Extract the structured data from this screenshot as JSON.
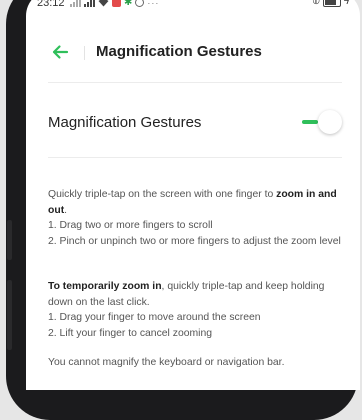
{
  "status": {
    "time": "23:12",
    "more": "···"
  },
  "header": {
    "title": "Magnification Gestures"
  },
  "setting": {
    "label": "Magnification Gestures",
    "enabled": true
  },
  "colors": {
    "accent": "#2fbf5a"
  },
  "icons": {
    "back": "arrow-left-icon"
  },
  "description": {
    "para1": {
      "lead": "Quickly triple-tap on the screen with one finger to ",
      "bold": "zoom in and out",
      "tail": ".",
      "item1": "1. Drag two or more fingers to scroll",
      "item2": "2. Pinch or unpinch two or more fingers to adjust the zoom level"
    },
    "para2": {
      "bold": "To temporarily zoom in",
      "tail": ", quickly triple-tap and keep holding down on the last click.",
      "item1": "1. Drag your finger to move around the screen",
      "item2": "2. Lift your finger to cancel zooming"
    },
    "para3": "You cannot magnify the keyboard or navigation bar."
  }
}
